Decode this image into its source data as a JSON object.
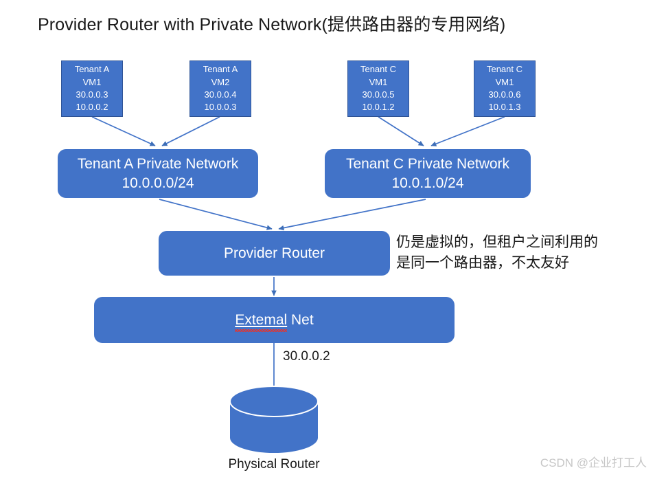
{
  "title": "Provider Router with Private Network(提供路由器的专用网络)",
  "vms": [
    {
      "name": "vm-tenant-a-vm1",
      "lines": [
        "Tenant A",
        "VM1",
        "30.0.0.3",
        "10.0.0.2"
      ]
    },
    {
      "name": "vm-tenant-a-vm2",
      "lines": [
        "Tenant A",
        "VM2",
        "30.0.0.4",
        "10.0.0.3"
      ]
    },
    {
      "name": "vm-tenant-c-vm1-a",
      "lines": [
        "Tenant C",
        "VM1",
        "30.0.0.5",
        "10.0.1.2"
      ]
    },
    {
      "name": "vm-tenant-c-vm1-b",
      "lines": [
        "Tenant C",
        "VM1",
        "30.0.0.6",
        "10.0.1.3"
      ]
    }
  ],
  "networks": [
    {
      "name": "tenant-a-private-network",
      "title": "Tenant A Private Network",
      "cidr": "10.0.0.0/24"
    },
    {
      "name": "tenant-c-private-network",
      "title": "Tenant C Private Network",
      "cidr": "10.0.1.0/24"
    }
  ],
  "provider_router": {
    "label": "Provider Router"
  },
  "external_net": {
    "misspelled_word": "Extemal",
    "rest": " Net"
  },
  "annotation": {
    "line1": "仍是虚拟的，但租户之间利用的",
    "line2": "是同一个路由器，不太友好"
  },
  "external_ip_label": "30.0.0.2",
  "physical_router": {
    "caption": "Physical Router"
  },
  "watermark": "CSDN @企业打工人",
  "colors": {
    "node_fill": "#4273c8",
    "node_border": "#2f5496",
    "connector": "#4273c8",
    "text_dark": "#1a1a1a",
    "spellcheck": "#e8322a",
    "watermark": "#c6c6c6"
  }
}
